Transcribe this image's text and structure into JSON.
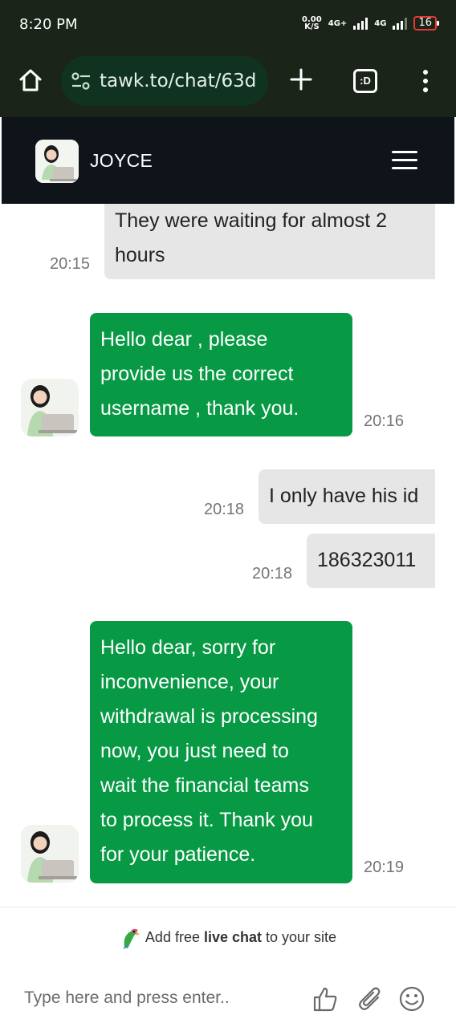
{
  "status_bar": {
    "time": "8:20 PM",
    "net_speed_value": "0.00",
    "net_speed_unit": "K/S",
    "network_1": "4G+",
    "network_2": "4G",
    "battery": "16"
  },
  "browser": {
    "url": "tawk.to/chat/63d",
    "icons": [
      "home-icon",
      "site-settings-icon",
      "new-tab-icon",
      "tab-switcher-icon",
      "more-menu-icon"
    ],
    "tab_switcher_label": ":D"
  },
  "chat_header": {
    "agent_name": "JOYCE",
    "menu_icon": "hamburger-menu-icon"
  },
  "messages": [
    {
      "sender": "visitor",
      "text_lines": [
        "They were waiting for almost 2",
        "hours"
      ],
      "time": "20:15"
    },
    {
      "sender": "agent",
      "text_lines": [
        "Hello dear , please",
        "provide us the correct",
        "username , thank you."
      ],
      "time": "20:16"
    },
    {
      "sender": "visitor",
      "text_lines": [
        "I only have his id"
      ],
      "time": "20:18"
    },
    {
      "sender": "visitor",
      "text_lines": [
        "186323011"
      ],
      "time": "20:18"
    },
    {
      "sender": "agent",
      "text_lines": [
        "Hello dear, sorry for",
        "inconvenience, your",
        "withdrawal is processing",
        "now, you just need to",
        "wait the financial teams",
        "to process it. Thank you",
        "for your patience."
      ],
      "time": "20:19"
    }
  ],
  "branding": {
    "prefix": "Add free ",
    "bold": "live chat",
    "suffix": " to your site"
  },
  "composer": {
    "placeholder": "Type here and press enter..",
    "value": "",
    "icons": [
      "thumbs-up-icon",
      "attachment-icon",
      "emoji-icon"
    ]
  },
  "colors": {
    "agent_bubble": "#089945",
    "visitor_bubble": "#e6e6e6",
    "header_bg": "#0f131a",
    "browser_bg": "#1a2419"
  }
}
